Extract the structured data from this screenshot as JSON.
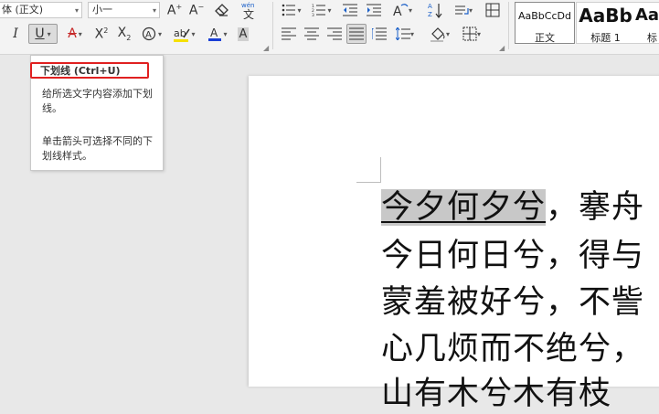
{
  "ribbon": {
    "font_name": "体 (正文)",
    "font_size": "小一",
    "styles": [
      {
        "sample": "AaBbCcDd",
        "name": "正文"
      },
      {
        "sample": "AaBb",
        "name": "标题 1"
      },
      {
        "sample": "Aa",
        "name": "标"
      }
    ]
  },
  "tooltip": {
    "title": "下划线 (Ctrl+U)",
    "line1": "给所选文字内容添加下划线。",
    "line2": "单击箭头可选择不同的下划线样式。"
  },
  "document": {
    "lines": [
      {
        "selected": "今夕何夕兮",
        "rest": "，搴舟"
      },
      {
        "text": "今日何日兮，得与"
      },
      {
        "text": "蒙羞被好兮，不訾"
      },
      {
        "text": "心几烦而不绝兮，"
      },
      {
        "text": "山有木兮木有枝"
      }
    ]
  },
  "colors": {
    "font_color_bar": "#1a3fd6",
    "highlight_bar": "#f5e000",
    "tooltip_border": "#e02020"
  }
}
